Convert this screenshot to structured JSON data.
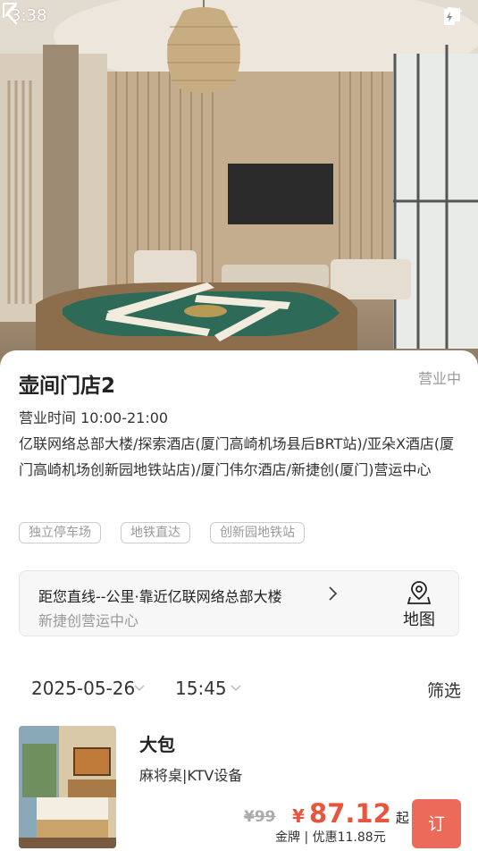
{
  "status_bar": {
    "time": "3:38",
    "icons": [
      "wifi-icon",
      "signal-icon",
      "battery-icon"
    ]
  },
  "hero": {
    "back_icon": "chevron-left-icon",
    "share_icon": "share-icon"
  },
  "store": {
    "name": "壶间门店2",
    "status": "营业中",
    "hours": "营业时间 10:00-21:00",
    "address": "亿联网络总部大楼/探索酒店(厦门高崎机场县后BRT站)/亚朵X酒店(厦门高崎机场创新园地铁站店)/厦门伟尔酒店/新捷创(厦门)营运中心",
    "tags": [
      "独立停车场",
      "地铁直达",
      "创新园地铁站"
    ]
  },
  "distance": {
    "main": "距您直线--公里·靠近亿联网络总部大楼",
    "sub": "新捷创营运中心",
    "map_label": "地图"
  },
  "filters": {
    "date": "2025-05-26",
    "time": "15:45",
    "filter_label": "筛选"
  },
  "rooms": [
    {
      "name": "大包",
      "features": "麻将桌|KTV设备",
      "original_price": "¥99",
      "price_symbol": "¥",
      "price": "87.12",
      "price_suffix": "起",
      "member_line": "金牌 | 优惠11.88元",
      "book_label": "订"
    }
  ],
  "colors": {
    "accent": "#e8553f",
    "book_button": "#eb6a5a",
    "muted": "#999999"
  }
}
